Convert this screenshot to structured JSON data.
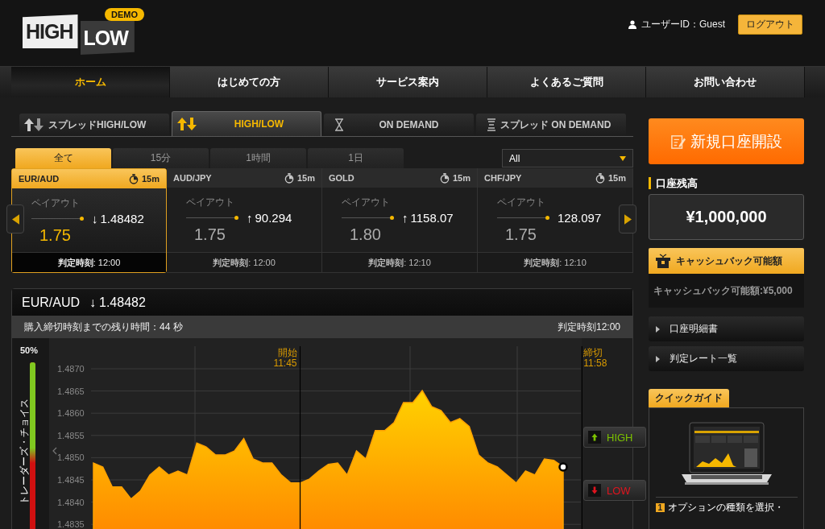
{
  "header": {
    "logo": {
      "high": "HIGH",
      "low": "LOW",
      "badge": "DEMO"
    },
    "user_id": "ユーザーID：Guest",
    "logout_button": "ログアウト"
  },
  "nav": [
    {
      "label": "ホーム",
      "selected": true
    },
    {
      "label": "はじめての方",
      "selected": false
    },
    {
      "label": "サービス案内",
      "selected": false
    },
    {
      "label": "よくあるご質問",
      "selected": false
    },
    {
      "label": "お問い合わせ",
      "selected": false
    }
  ],
  "product_tabs": [
    {
      "label": "スプレッドHIGH/LOW",
      "kind": "spread",
      "selected": false
    },
    {
      "label": "HIGH/LOW",
      "kind": "highlow",
      "selected": true
    },
    {
      "label": "ON DEMAND",
      "kind": "ondemand",
      "selected": false
    },
    {
      "label": "スプレッド ON DEMAND",
      "kind": "spread_ondemand",
      "selected": false
    }
  ],
  "duration_tabs": [
    {
      "label": "全て",
      "selected": true
    },
    {
      "label": "15分",
      "selected": false
    },
    {
      "label": "1時間",
      "selected": false
    },
    {
      "label": "1日",
      "selected": false
    }
  ],
  "asset_filter": {
    "value": "All"
  },
  "assets": [
    {
      "name": "EUR/AUD",
      "duration": "15m",
      "payout_label": "ペイアウト",
      "payout": "1.75",
      "arrow": "↓",
      "rate": "1.48482",
      "expiry": "**判定時刻**: 12:00",
      "selected": true
    },
    {
      "name": "AUD/JPY",
      "duration": "15m",
      "payout_label": "ペイアウト",
      "payout": "1.75",
      "arrow": "↑",
      "rate": "90.294",
      "expiry": "**判定時刻**: 12:00",
      "selected": false
    },
    {
      "name": "GOLD",
      "duration": "15m",
      "payout_label": "ペイアウト",
      "payout": "1.80",
      "arrow": "↑",
      "rate": "1158.07",
      "expiry": "**判定時刻**: 12:10",
      "selected": false
    },
    {
      "name": "CHF/JPY",
      "duration": "15m",
      "payout_label": "ペイアウト",
      "payout": "1.75",
      "rate": "128.097",
      "expiry": "**判定時刻**: 12:10",
      "selected": false
    }
  ],
  "chart_panel": {
    "asset": "EUR/AUD",
    "arrow": "↓",
    "rate": "1.48482",
    "countdown": "購入締切時刻までの残り時間：44 秒",
    "expiry": "判定時刻12:00",
    "traders_choice": {
      "label": "トレーダーズ・チョイス",
      "percent": "50%",
      "level": 0.5
    },
    "chart_data": {
      "type": "area",
      "ylim": [
        1.4834,
        1.4875
      ],
      "grid": true,
      "yticks": [
        {
          "value": 1.487,
          "label": "1.4870"
        },
        {
          "value": 1.4865,
          "label": "1.4865"
        },
        {
          "value": 1.486,
          "label": "1.4860"
        },
        {
          "value": 1.4855,
          "label": "1.4855"
        },
        {
          "value": 1.485,
          "label": "1.4850"
        },
        {
          "value": 1.4845,
          "label": "1.4845"
        },
        {
          "value": 1.484,
          "label": "1.4840"
        },
        {
          "value": 1.4835,
          "label": "1.4835"
        }
      ],
      "series": [
        {
          "color": "#ffa200",
          "values": [
            1.48488,
            1.48479,
            1.48434,
            1.48434,
            1.48407,
            1.48425,
            1.48461,
            1.48479,
            1.48461,
            1.4847,
            1.48461,
            1.48533,
            1.48524,
            1.48506,
            1.48506,
            1.48515,
            1.48543,
            1.48497,
            1.48488,
            1.48488,
            1.48461,
            1.48443,
            1.48443,
            1.48452,
            1.4847,
            1.48485,
            1.48488,
            1.48461,
            1.48515,
            1.48497,
            1.48561,
            1.48561,
            1.48579,
            1.48624,
            1.48624,
            1.48651,
            1.48615,
            1.48606,
            1.48579,
            1.48588,
            1.4857,
            1.48506,
            1.48488,
            1.48479,
            1.48461,
            1.48443,
            1.4847,
            1.48461,
            1.48497,
            1.48494,
            1.48479
          ]
        }
      ],
      "annotations": [
        "開始 11:45",
        "締切 11:58"
      ]
    },
    "high_button": "HIGH",
    "low_button": "LOW"
  },
  "sidebar": {
    "new_account_button": "新規口座開設",
    "balance_label": "口座残高",
    "balance": "¥1,000,000",
    "cashback_title": "キャッシュバック可能額",
    "cashback_text": "キャッシュバック可能額:¥5,000",
    "links": [
      "口座明細書",
      "判定レート一覧"
    ],
    "guide_tab": "クイックガイド",
    "guide_step": {
      "number": "1",
      "text": "オプションの種類を選択・"
    }
  }
}
